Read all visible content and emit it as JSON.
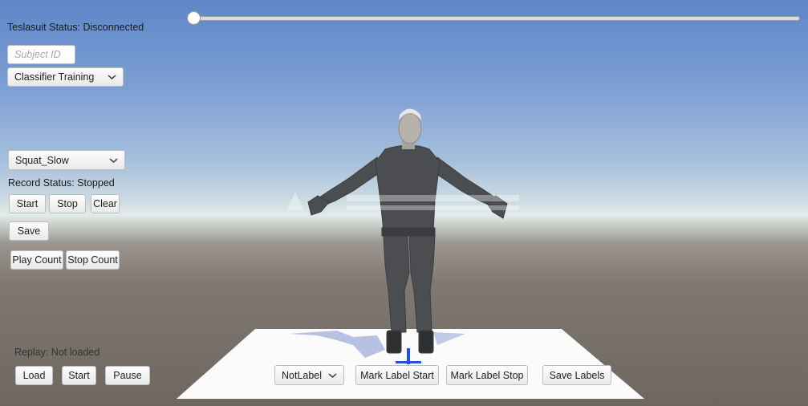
{
  "timeline": {
    "value": 0
  },
  "status": {
    "teslasuit": "Teslasuit Status: Disconnected",
    "record": "Record Status: Stopped",
    "replay": "Replay: Not loaded"
  },
  "subject": {
    "placeholder": "Subject ID",
    "value": ""
  },
  "mode_select": {
    "selected": "Classifier Training"
  },
  "exercise_select": {
    "selected": "Squat_Slow"
  },
  "record_controls": {
    "start": "Start",
    "stop": "Stop",
    "clear": "Clear",
    "save": "Save"
  },
  "count_controls": {
    "play": "Play Count",
    "stop": "Stop Count"
  },
  "replay_controls": {
    "load": "Load",
    "start": "Start",
    "pause": "Pause"
  },
  "label_controls": {
    "selected": "NotLabel",
    "mark_start": "Mark Label Start",
    "mark_stop": "Mark Label Stop",
    "save": "Save Labels"
  },
  "colors": {
    "suit": "#4b4d50",
    "skin": "#b7b2ac",
    "floor": "#fbfbfb",
    "axis_blue": "#2b4fd1"
  }
}
